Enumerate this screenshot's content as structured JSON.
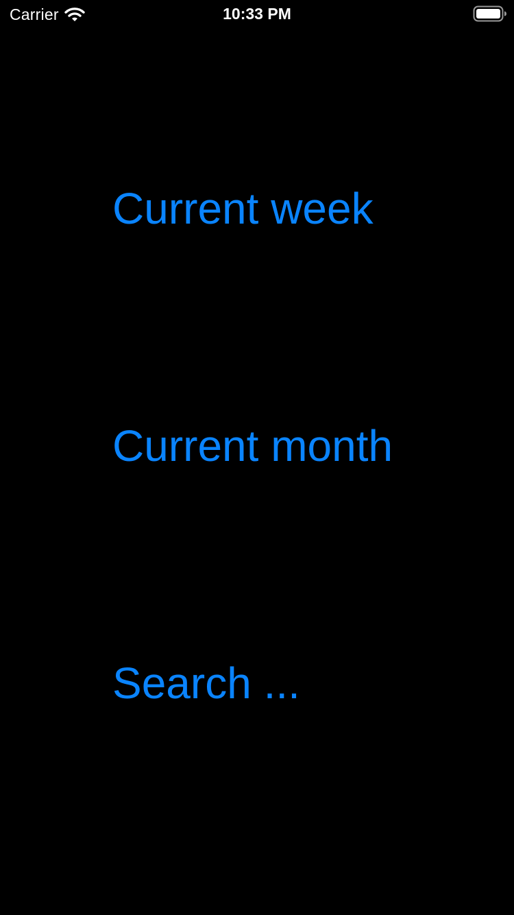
{
  "status_bar": {
    "carrier": "Carrier",
    "time": "10:33 PM",
    "icons": {
      "wifi": "wifi-icon",
      "battery": "battery-icon"
    }
  },
  "menu": {
    "items": [
      {
        "label": "Current week"
      },
      {
        "label": "Current month"
      },
      {
        "label": "Search ..."
      }
    ]
  },
  "colors": {
    "background": "#000000",
    "status_text": "#ffffff",
    "accent": "#0A84FF"
  }
}
